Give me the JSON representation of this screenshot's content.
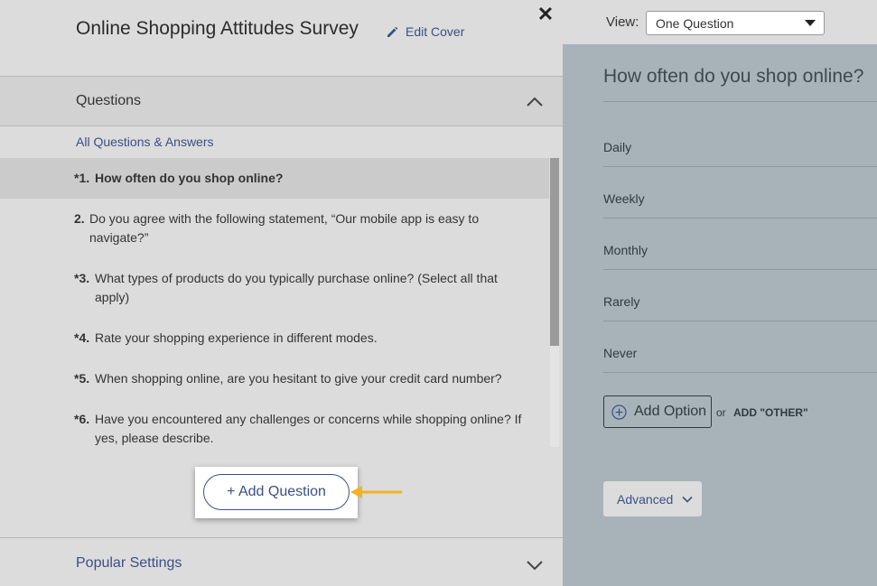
{
  "header": {
    "survey_title": "Online Shopping Attitudes Survey",
    "edit_cover_label": "Edit Cover",
    "close_glyph": "✕"
  },
  "questions_section": {
    "title": "Questions",
    "all_link": "All Questions & Answers",
    "items": [
      {
        "num": "*1.",
        "text": "How often do you shop online?"
      },
      {
        "num": "2.",
        "text": "Do you agree with the following statement, “Our mobile app is easy to navigate?”"
      },
      {
        "num": "*3.",
        "text": "What types of products do you typically purchase online? (Select all that apply)"
      },
      {
        "num": "*4.",
        "text": "Rate your shopping experience in different modes."
      },
      {
        "num": "*5.",
        "text": "When shopping online, are you hesitant to give your credit card number?"
      },
      {
        "num": "*6.",
        "text": "Have you encountered any challenges or concerns while shopping online? If yes, please describe."
      }
    ],
    "add_question_label": "+ Add Question"
  },
  "popular_settings": {
    "title": "Popular Settings"
  },
  "view": {
    "label": "View:",
    "selected": "One Question"
  },
  "preview": {
    "question": "How often do you shop online?",
    "options": [
      "Daily",
      "Weekly",
      "Monthly",
      "Rarely",
      "Never"
    ],
    "add_option_label": "Add Option",
    "or_text": "or",
    "add_other_label": "ADD \"OTHER\"",
    "advanced_label": "Advanced"
  },
  "colors": {
    "accent": "#3a4f85",
    "arrow": "#f0b323",
    "panel_bg": "#dcdcdc",
    "preview_bg": "#a8b3b9"
  }
}
